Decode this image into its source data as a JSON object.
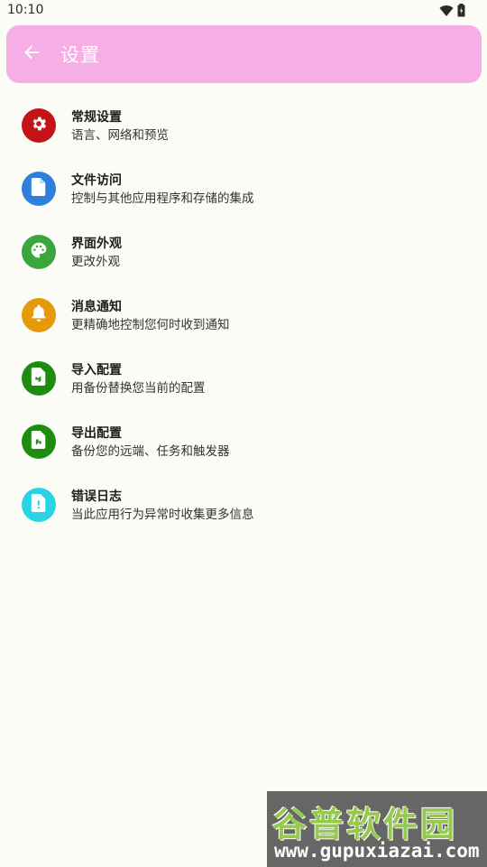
{
  "status_bar": {
    "time": "10:10",
    "icons": [
      "wifi-icon",
      "battery-icon"
    ]
  },
  "app_bar": {
    "back_icon": "arrow-left-icon",
    "title": "设置",
    "color": "#f6aee6"
  },
  "settings": [
    {
      "title": "常规设置",
      "subtitle": "语言、网络和预览",
      "icon": "gear-icon",
      "color": "#c3141a"
    },
    {
      "title": "文件访问",
      "subtitle": "控制与其他应用程序和存储的集成",
      "icon": "file-icon",
      "color": "#2f7fdc"
    },
    {
      "title": "界面外观",
      "subtitle": "更改外观",
      "icon": "palette-icon",
      "color": "#3aa63c"
    },
    {
      "title": "消息通知",
      "subtitle": "更精确地控制您何时收到通知",
      "icon": "bell-icon",
      "color": "#e59a09"
    },
    {
      "title": "导入配置",
      "subtitle": "用备份替换您当前的配置",
      "icon": "file-import-icon",
      "color": "#1e8c0e"
    },
    {
      "title": "导出配置",
      "subtitle": "备份您的远端、任务和触发器",
      "icon": "file-export-icon",
      "color": "#1e8c0e"
    },
    {
      "title": "错误日志",
      "subtitle": "当此应用行为异常时收集更多信息",
      "icon": "file-alert-icon",
      "color": "#2ad3e4"
    }
  ],
  "watermark": {
    "name": "谷普软件园",
    "url": "www.gupuxiazai.com"
  }
}
